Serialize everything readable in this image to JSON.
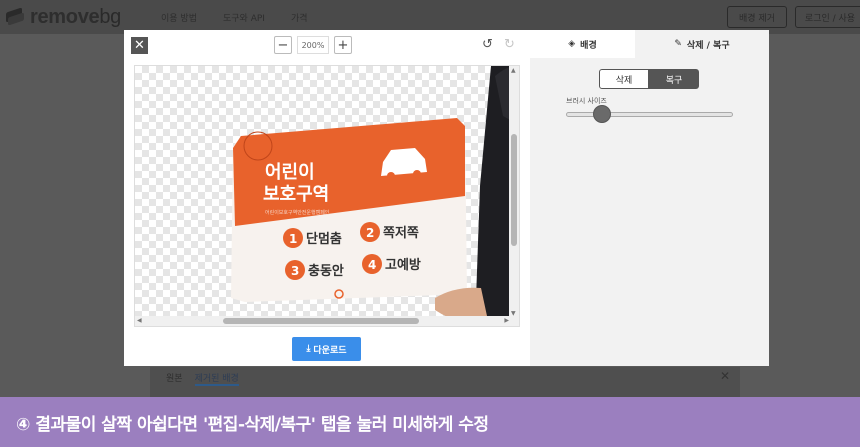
{
  "header": {
    "logo_main": "remove",
    "logo_suffix": "bg",
    "nav": [
      "이용 방법",
      "도구와 API",
      "가격"
    ],
    "remove_bg_button": "배경 제거",
    "login_button": "로그인 / 사용"
  },
  "below_modal": {
    "tabs": [
      "원본",
      "제거된 배경"
    ],
    "close": "✕"
  },
  "modal": {
    "close": "✕",
    "zoom": {
      "minus": "−",
      "value": "200%",
      "plus": "+"
    },
    "undo": "↺",
    "redo": "↻",
    "download_label": "다운로드",
    "tabs": {
      "background": "배경",
      "erase_restore": "삭제 / 복구"
    },
    "segment": {
      "erase": "삭제",
      "restore": "복구",
      "selected": "복구"
    },
    "brush_size_label": "브러시 사이즈",
    "brush_size_fraction": 0.25
  },
  "sign": {
    "title_line1": "어린이",
    "title_line2": "보호구역",
    "small_text": "어린이보호구역안전운행캠페인",
    "item1_num": "1",
    "item1_text": "단멈춤",
    "item2_num": "2",
    "item2_text": "쪽저쪽",
    "item3_num": "3",
    "item3_text": "충동안",
    "item4_num": "4",
    "item4_text": "고예방"
  },
  "colors": {
    "accent_orange": "#e8622c",
    "download_blue": "#3a8eea",
    "caption_purple": "#9b7fbf"
  },
  "caption": "④ 결과물이 살짝 아쉽다면 '편집-삭제/복구' 탭을 눌러 미세하게 수정"
}
